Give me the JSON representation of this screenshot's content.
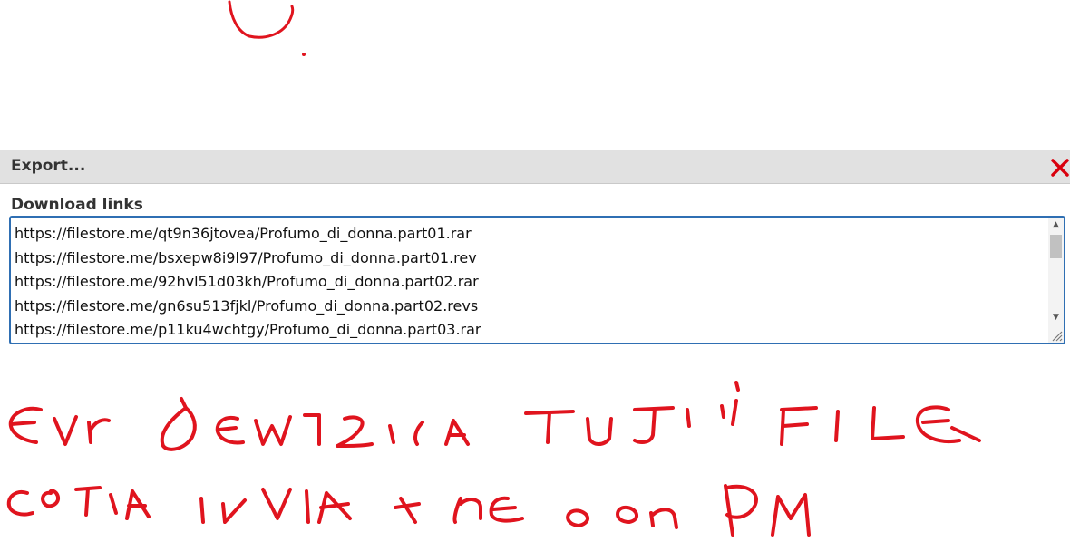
{
  "dialog": {
    "title": "Export...",
    "close_icon": "close-icon",
    "close_color": "#d9000d",
    "header_bg": "#e1e1e1"
  },
  "download": {
    "label": "Download links",
    "links": [
      "https://filestore.me/qt9n36jtovea/Profumo_di_donna.part01.rar",
      "https://filestore.me/bsxepw8i9l97/Profumo_di_donna.part01.rev",
      "https://filestore.me/92hvl51d03kh/Profumo_di_donna.part02.rar",
      "https://filestore.me/gn6su513fjkl/Profumo_di_donna.part02.revs",
      "https://filestore.me/p11ku4wchtgy/Profumo_di_donna.part03.rar"
    ],
    "border_color": "#2f6fb3"
  },
  "annotations": {
    "ink_color": "#e0141e"
  }
}
